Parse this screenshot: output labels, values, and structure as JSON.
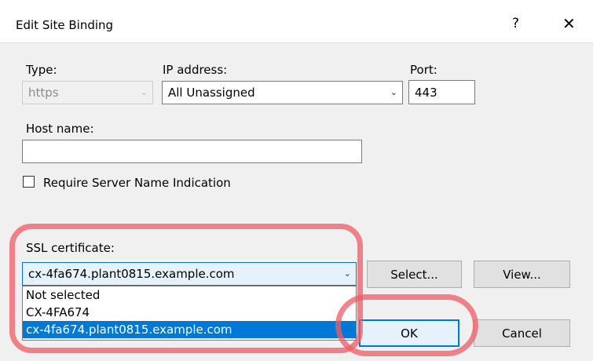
{
  "window": {
    "title": "Edit Site Binding",
    "help_symbol": "?",
    "close_symbol": "✕"
  },
  "type": {
    "label": "Type:",
    "value": "https"
  },
  "ip": {
    "label": "IP address:",
    "value": "All Unassigned"
  },
  "port": {
    "label": "Port:",
    "value": "443"
  },
  "host": {
    "label": "Host name:",
    "value": ""
  },
  "sni": {
    "label": "Require Server Name Indication",
    "checked": false
  },
  "ssl": {
    "label": "SSL certificate:",
    "value": "cx-4fa674.plant0815.example.com",
    "options": [
      "Not selected",
      "CX-4FA674",
      "cx-4fa674.plant0815.example.com"
    ],
    "selected_index": 2
  },
  "buttons": {
    "select": "Select...",
    "view": "View...",
    "ok": "OK",
    "cancel": "Cancel"
  },
  "icons": {
    "dropdown": "chevron-down-icon",
    "close": "close-icon",
    "help": "help-icon"
  },
  "colors": {
    "selection": "#0078d7",
    "highlight": "#ee5c66"
  }
}
